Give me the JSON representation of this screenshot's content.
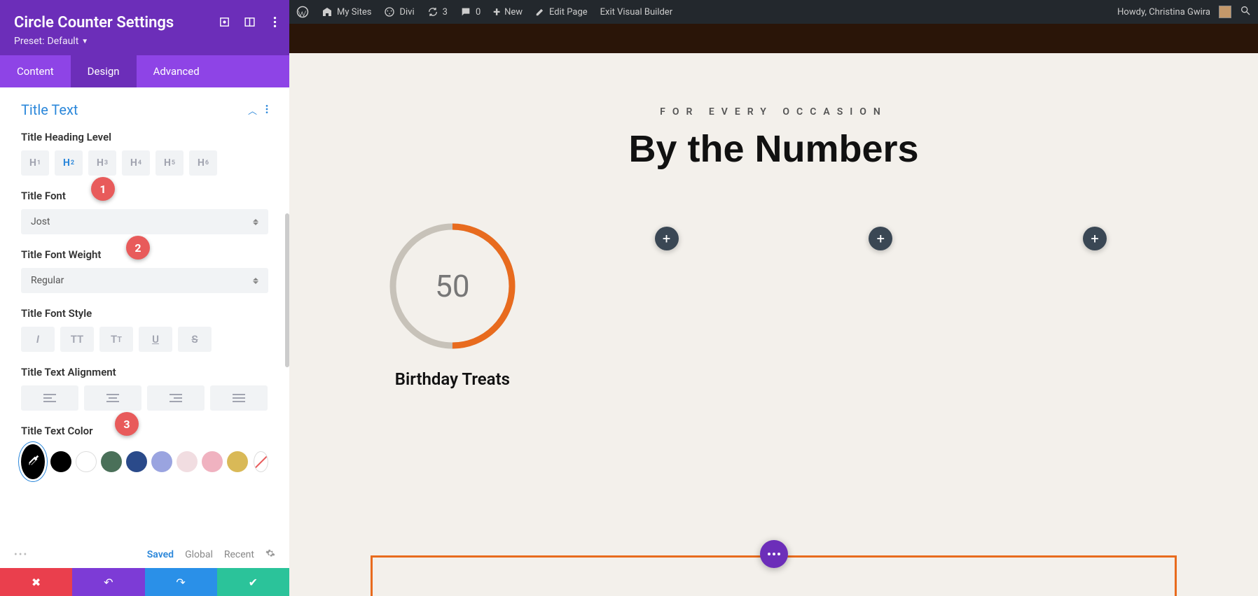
{
  "panel": {
    "title": "Circle Counter Settings",
    "preset_prefix": "Preset:",
    "preset_value": "Default"
  },
  "tabs": {
    "content": "Content",
    "design": "Design",
    "advanced": "Advanced"
  },
  "section": {
    "title": "Title Text"
  },
  "fields": {
    "heading_level": {
      "label": "Title Heading Level",
      "active": "H2"
    },
    "title_font": {
      "label": "Title Font",
      "value": "Jost"
    },
    "title_weight": {
      "label": "Title Font Weight",
      "value": "Regular"
    },
    "title_style": {
      "label": "Title Font Style"
    },
    "title_align": {
      "label": "Title Text Alignment"
    },
    "title_color": {
      "label": "Title Text Color"
    }
  },
  "annotations": {
    "a1": "1",
    "a2": "2",
    "a3": "3"
  },
  "swatches": [
    "#000000",
    "#ffffff",
    "#4a7059",
    "#2a4a8a",
    "#9aa4e0",
    "#f1dde1",
    "#f0b2c0",
    "#d9b957"
  ],
  "status": {
    "saved": "Saved",
    "global": "Global",
    "recent": "Recent"
  },
  "adminbar": {
    "mysites": "My Sites",
    "divi": "Divi",
    "updates": "3",
    "comments": "0",
    "new": "New",
    "edit": "Edit Page",
    "exit": "Exit Visual Builder",
    "howdy": "Howdy, Christina Gwira"
  },
  "preview": {
    "kicker": "FOR EVERY OCCASION",
    "headline": "By the Numbers",
    "counter": {
      "value": "50",
      "label": "Birthday Treats",
      "percent": 50
    }
  }
}
